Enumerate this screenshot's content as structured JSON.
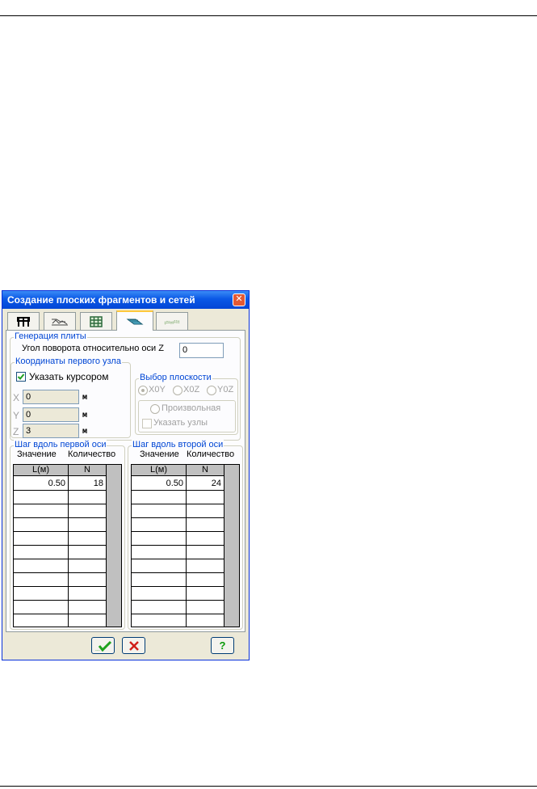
{
  "dialog": {
    "title": "Создание плоских фрагментов и сетей",
    "tabs": [
      {
        "icon": "frame-icon"
      },
      {
        "icon": "truss-icon"
      },
      {
        "icon": "grid-icon"
      },
      {
        "icon": "plate-icon",
        "active": true
      },
      {
        "icon": "shell-icon"
      }
    ],
    "plate_generation": {
      "legend": "Генерация плиты",
      "rotation_label": "Угол поворота относительно оси Z",
      "rotation_value": "0"
    },
    "first_node": {
      "legend": "Координаты первого узла",
      "cursor_label": "Указать курсором",
      "cursor_checked": true,
      "x_label": "X",
      "x_value": "0",
      "y_label": "Y",
      "y_value": "0",
      "z_label": "Z",
      "z_value": "3",
      "unit": "м"
    },
    "plane": {
      "legend": "Выбор плоскости",
      "options": [
        "X0Y",
        "X0Z",
        "Y0Z"
      ],
      "selected": "X0Y",
      "arbitrary_label": "Произвольная",
      "nodes_label": "Указать узлы"
    },
    "step1": {
      "legend": "Шаг вдоль первой оси",
      "col_value": "Значение",
      "col_count": "Количество",
      "hdr_l": "L(м)",
      "hdr_n": "N",
      "rows": [
        {
          "l": "0.50",
          "n": "18"
        }
      ]
    },
    "step2": {
      "legend": "Шаг вдоль второй оси",
      "col_value": "Значение",
      "col_count": "Количество",
      "hdr_l": "L(м)",
      "hdr_n": "N",
      "rows": [
        {
          "l": "0.50",
          "n": "24"
        }
      ]
    },
    "buttons": {
      "ok": "check-icon",
      "cancel": "cross-icon",
      "help": "?"
    }
  }
}
